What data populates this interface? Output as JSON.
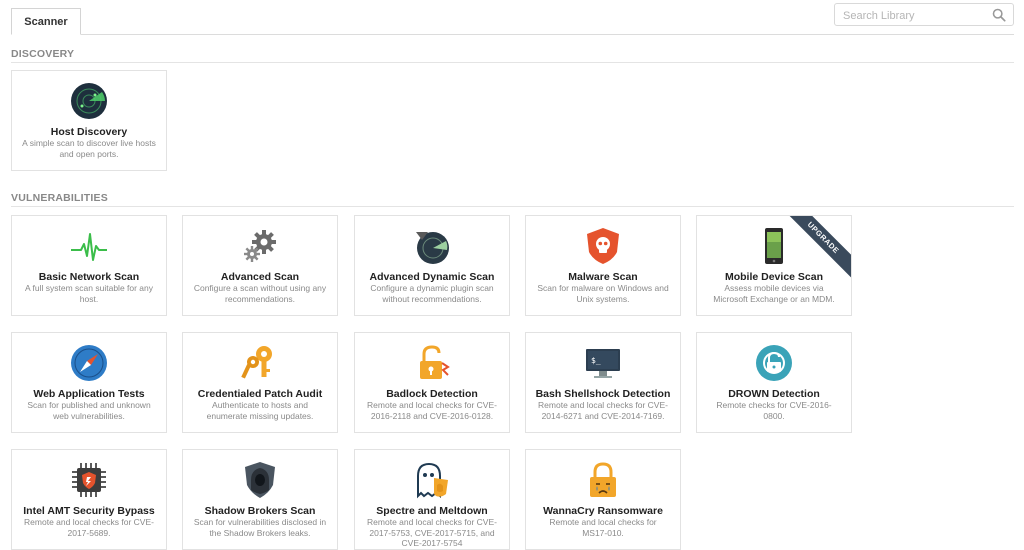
{
  "tabs": {
    "scanner": "Scanner"
  },
  "search": {
    "placeholder": "Search Library",
    "icon": "magnifier-icon"
  },
  "sections": {
    "discovery": "DISCOVERY",
    "vulnerabilities": "VULNERABILITIES"
  },
  "cards": {
    "host_discovery": {
      "title": "Host Discovery",
      "desc": "A simple scan to discover live hosts and open ports."
    },
    "basic_network": {
      "title": "Basic Network Scan",
      "desc": "A full system scan suitable for any host."
    },
    "advanced": {
      "title": "Advanced Scan",
      "desc": "Configure a scan without using any recommendations."
    },
    "advanced_dynamic": {
      "title": "Advanced Dynamic Scan",
      "desc": "Configure a dynamic plugin scan without recommendations."
    },
    "malware": {
      "title": "Malware Scan",
      "desc": "Scan for malware on Windows and Unix systems."
    },
    "mobile_device": {
      "title": "Mobile Device Scan",
      "desc": "Assess mobile devices via Microsoft Exchange or an MDM.",
      "badge": "UPGRADE"
    },
    "web_app": {
      "title": "Web Application Tests",
      "desc": "Scan for published and unknown web vulnerabilities."
    },
    "credentialed_patch": {
      "title": "Credentialed Patch Audit",
      "desc": "Authenticate to hosts and enumerate missing updates."
    },
    "badlock": {
      "title": "Badlock Detection",
      "desc": "Remote and local checks for CVE-2016-2118 and CVE-2016-0128."
    },
    "bash_shellshock": {
      "title": "Bash Shellshock Detection",
      "desc": "Remote and local checks for CVE-2014-6271 and CVE-2014-7169."
    },
    "drown": {
      "title": "DROWN Detection",
      "desc": "Remote checks for CVE-2016-0800."
    },
    "intel_amt": {
      "title": "Intel AMT Security Bypass",
      "desc": "Remote and local checks for CVE-2017-5689."
    },
    "shadow_brokers": {
      "title": "Shadow Brokers Scan",
      "desc": "Scan for vulnerabilities disclosed in the Shadow Brokers leaks."
    },
    "spectre_meltdown": {
      "title": "Spectre and Meltdown",
      "desc": "Remote and local checks for CVE-2017-5753, CVE-2017-5715, and CVE-2017-5754"
    },
    "wannacry": {
      "title": "WannaCry Ransomware",
      "desc": "Remote and local checks for MS17-010."
    }
  },
  "colors": {
    "accent_green": "#3bbd4a",
    "accent_orange": "#f2a62a",
    "malware_red": "#e5532d",
    "navy": "#1f3a52",
    "teal": "#3aa3b8",
    "blue": "#2e7cc7"
  }
}
